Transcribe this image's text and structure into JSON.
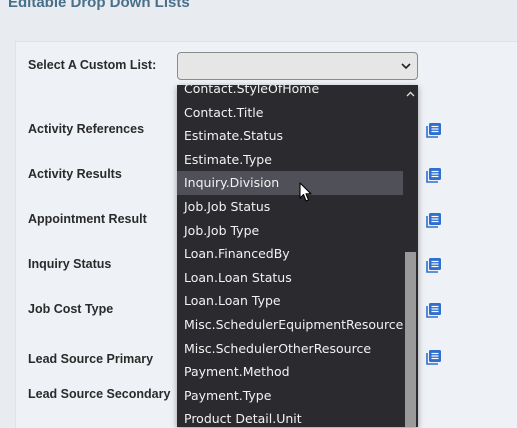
{
  "page": {
    "title": "Editable Drop Down Lists"
  },
  "custom_list": {
    "label": "Select A Custom List:",
    "selected_value": ""
  },
  "rows": [
    {
      "label": "Activity References"
    },
    {
      "label": "Activity Results"
    },
    {
      "label": "Appointment Result"
    },
    {
      "label": "Inquiry Status"
    },
    {
      "label": "Job Cost Type"
    },
    {
      "label": "Lead Source Primary"
    },
    {
      "label": "Lead Source Secondary"
    }
  ],
  "dropdown": {
    "items": [
      "Contact.StyleOfHome",
      "Contact.Title",
      "Estimate.Status",
      "Estimate.Type",
      "Inquiry.Division",
      "Job.Job Status",
      "Job.Job Type",
      "Loan.FinancedBy",
      "Loan.Loan Status",
      "Loan.Loan Type",
      "Misc.SchedulerEquipmentResource",
      "Misc.SchedulerOtherResource",
      "Payment.Method",
      "Payment.Type",
      "Product Detail.Unit"
    ],
    "hovered_item": "Inquiry.Division"
  },
  "icons": {
    "edit": "edit-list-icon",
    "chevron": "chevron-down-icon",
    "scroll_up": "scroll-up-icon"
  },
  "colors": {
    "accent": "#2f6fd0",
    "title": "#4a6f8a",
    "dropdown_bg": "#2b2b2f"
  }
}
